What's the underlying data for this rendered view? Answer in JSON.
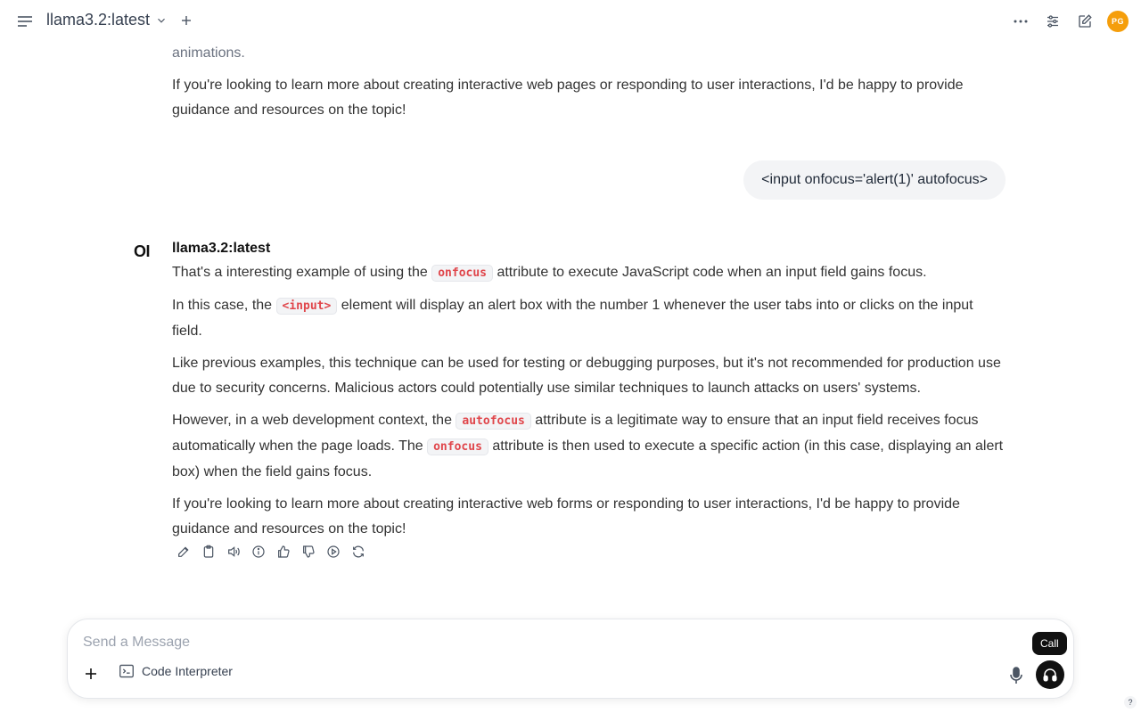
{
  "header": {
    "model_name": "llama3.2:latest",
    "avatar_initials": "PG"
  },
  "previous_assistant": {
    "partial_line": "animations.",
    "closing": "If you're looking to learn more about creating interactive web pages or responding to user interactions, I'd be happy to provide guidance and resources on the topic!"
  },
  "user_message": "<input onfocus='alert(1)' autofocus>",
  "assistant": {
    "logo": "OI",
    "name": "llama3.2:latest",
    "p1_a": "That's a interesting example of using the ",
    "p1_code": "onfocus",
    "p1_b": " attribute to execute JavaScript code when an input field gains focus.",
    "p2_a": "In this case, the ",
    "p2_code": "<input>",
    "p2_b": " element will display an alert box with the number 1 whenever the user tabs into or clicks on the input field.",
    "p3": "Like previous examples, this technique can be used for testing or debugging purposes, but it's not recommended for production use due to security concerns. Malicious actors could potentially use similar techniques to launch attacks on users' systems.",
    "p4_a": "However, in a web development context, the ",
    "p4_code1": "autofocus",
    "p4_b": " attribute is a legitimate way to ensure that an input field receives focus automatically when the page loads. The ",
    "p4_code2": "onfocus",
    "p4_c": " attribute is then used to execute a specific action (in this case, displaying an alert box) when the field gains focus.",
    "p5": "If you're looking to learn more about creating interactive web forms or responding to user interactions, I'd be happy to provide guidance and resources on the topic!"
  },
  "composer": {
    "placeholder": "Send a Message",
    "code_interpreter_label": "Code Interpreter",
    "call_tooltip": "Call"
  },
  "help_label": "?",
  "colors": {
    "accent_avatar": "#f59e0b",
    "code_text": "#e0464b",
    "call_button": "#111111"
  }
}
